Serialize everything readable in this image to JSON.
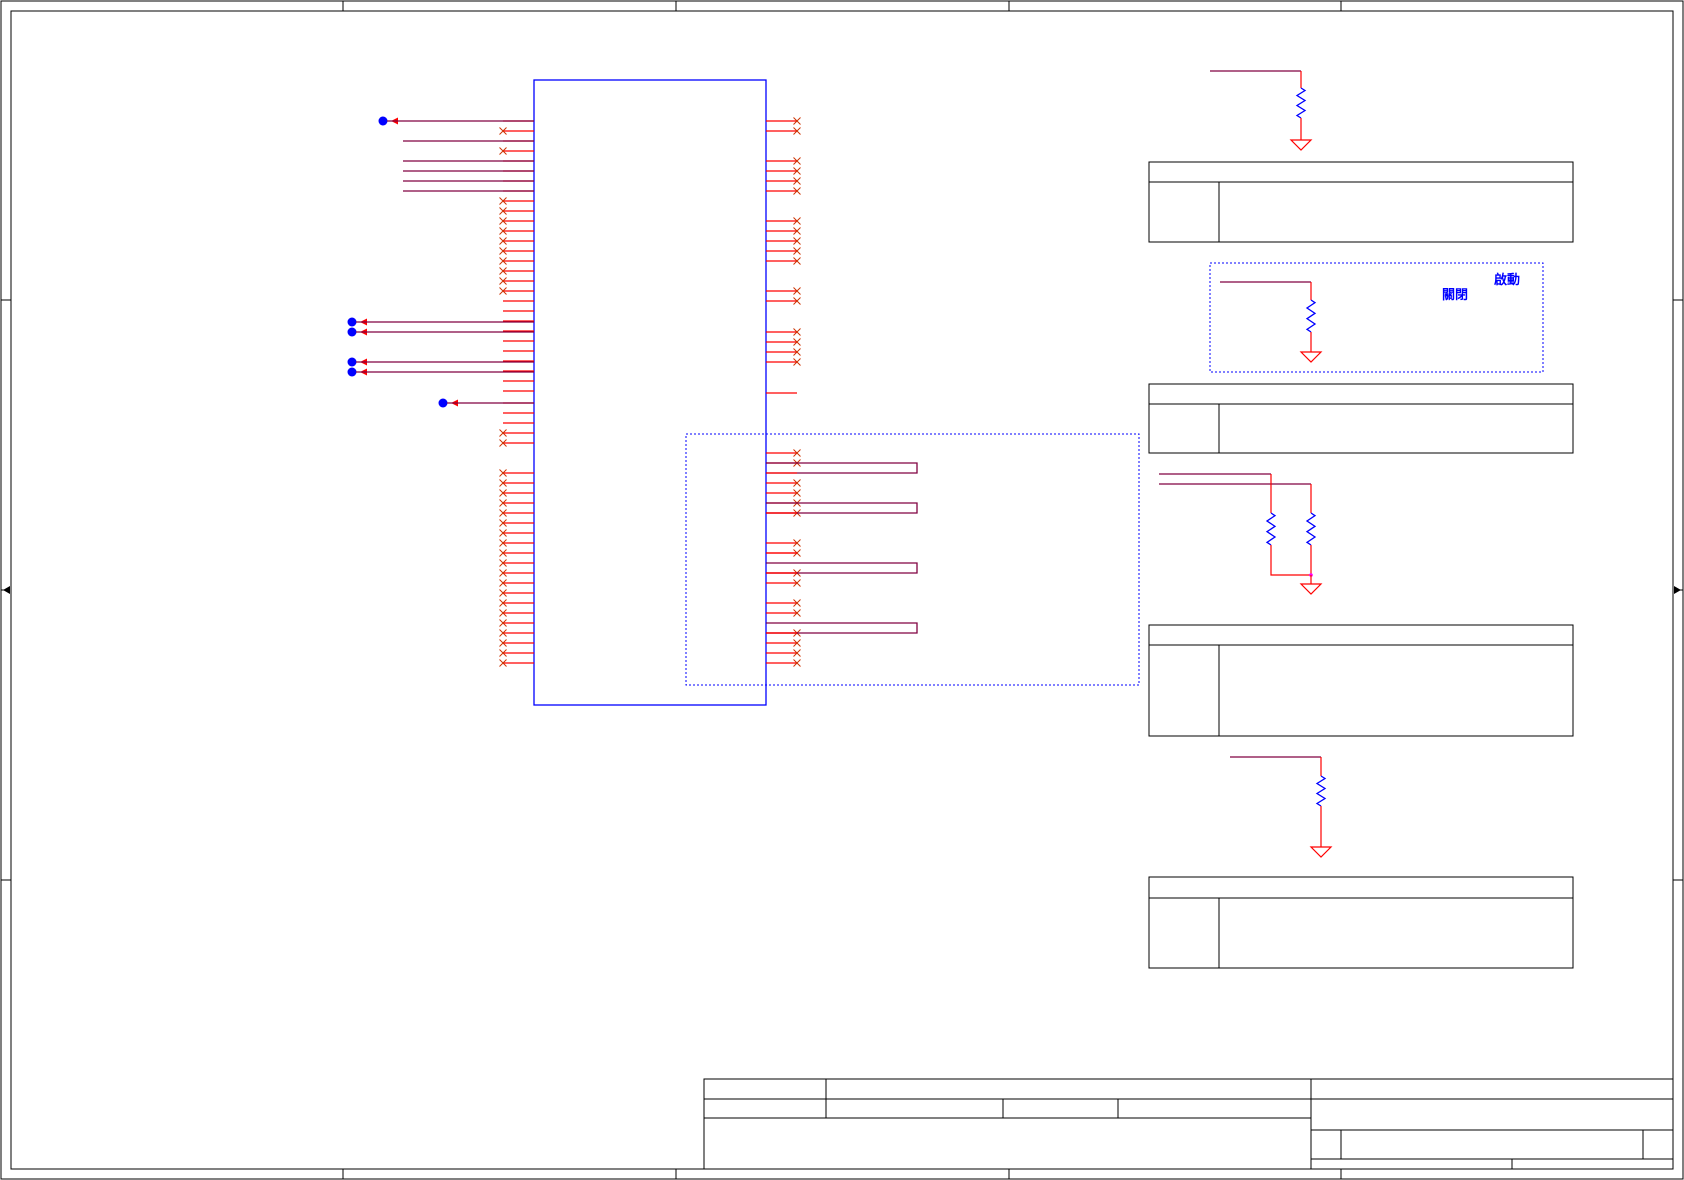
{
  "window": {
    "title": ""
  },
  "colors": {
    "frame": "#000000",
    "component": "#0000ff",
    "pin": "#ff0000",
    "net": "#800040",
    "noconnect": "#cc3300",
    "port": "#0000ff",
    "dashed": "#0000ff"
  },
  "notes": {
    "jumper_on": "啟動",
    "jumper_off": "關閉"
  },
  "icons": [
    "resistor-icon",
    "ground-icon",
    "power-port-icon",
    "no-connect-icon"
  ]
}
